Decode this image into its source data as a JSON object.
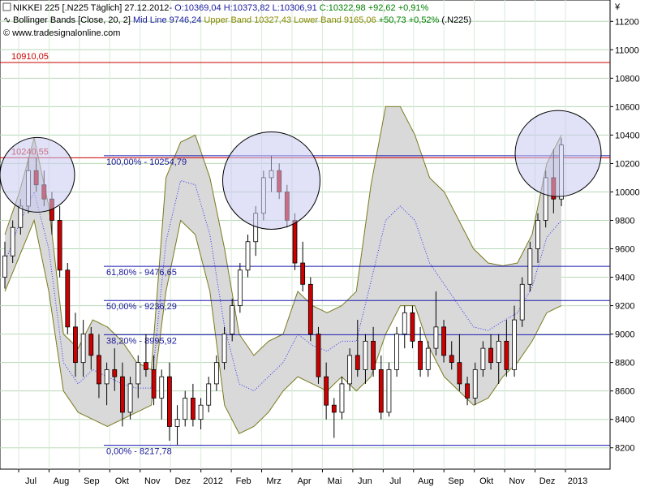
{
  "header": {
    "line1_name": "NIKKEI 225 [.N225  Täglich] 27.12.2012",
    "line1_ohlc": "- O:10369,04 H:10373,82 L:10306,91 ",
    "line1_close": "C:10322,98 +92,62 +0,91%",
    "line2_prefix": "Bollinger Bands [Close, 20, 2]",
    "line2_mid": " Mid Line 9746,24",
    "line2_bands": " Upper Band 10327,43 Lower Band 9165,06",
    "line2_change": " +50,73 +0,52%",
    "line2_suffix": " (.N225)",
    "copyright": "© www.tradesignalonline.com"
  },
  "colors": {
    "up_candle": "#ffffff",
    "down_candle": "#cc0000",
    "band_fill": "#d9d9d9",
    "band_line": "#7a7a1e",
    "mid_line": "#3030ff",
    "fib_line": "#1a1ab0",
    "resistance_line": "#cc0000",
    "circle_fill": "#c8c8f0"
  },
  "chart_data": {
    "type": "candlestick",
    "currency_label": "¥",
    "y_ticks": [
      8200,
      8400,
      8600,
      8800,
      9000,
      9200,
      9400,
      9600,
      9800,
      10000,
      10200,
      10400,
      10600,
      10800,
      11000,
      11200
    ],
    "y_tick_labels": [
      "8200",
      "8400",
      "8600",
      "8800",
      "9000",
      "9200",
      "9400",
      "9600",
      "9800",
      "10000",
      "10200",
      "10400",
      "10600",
      "10800",
      "11000",
      "11200"
    ],
    "ylim": [
      8050,
      11350
    ],
    "x_labels": [
      "Jul",
      "Aug",
      "Sep",
      "Okt",
      "Nov",
      "Dez",
      "2012",
      "Feb",
      "Mrz",
      "Apr",
      "Mai",
      "Jun",
      "Jul",
      "Aug",
      "Sep",
      "Okt",
      "Nov",
      "Dez",
      "2013"
    ],
    "bollinger_series": {
      "x": [
        0,
        10,
        20,
        30,
        40,
        50,
        60,
        70,
        80,
        90,
        100,
        110,
        120,
        130,
        140,
        150,
        160,
        170,
        180,
        190,
        200,
        210,
        220,
        230,
        240,
        250,
        260,
        270,
        280,
        290,
        300,
        310,
        320,
        330,
        340,
        350,
        360,
        370,
        380
      ],
      "upper": [
        9700,
        10000,
        10380,
        9900,
        9000,
        8900,
        9100,
        9050,
        8950,
        8800,
        8750,
        10100,
        10350,
        10400,
        10100,
        9600,
        9000,
        8850,
        8950,
        9000,
        9300,
        9200,
        9150,
        9200,
        9300,
        10050,
        10600,
        10600,
        10400,
        10100,
        10000,
        9800,
        9600,
        9500,
        9480,
        9500,
        9700,
        10200,
        10400
      ],
      "lower": [
        9300,
        9550,
        9800,
        9300,
        8600,
        8450,
        8400,
        8350,
        8400,
        8450,
        8500,
        9300,
        9800,
        9700,
        9300,
        8500,
        8300,
        8350,
        8450,
        8600,
        8700,
        8650,
        8600,
        8700,
        8600,
        8700,
        9000,
        9200,
        9200,
        8900,
        8700,
        8600,
        8500,
        8550,
        8700,
        8800,
        8950,
        9150,
        9200
      ],
      "mid": [
        9500,
        9780,
        10000,
        9600,
        8800,
        8650,
        8750,
        8700,
        8650,
        8620,
        8620,
        9650,
        10080,
        10050,
        9700,
        9050,
        8650,
        8600,
        8700,
        8800,
        9000,
        8920,
        8880,
        8950,
        8950,
        9370,
        9800,
        9900,
        9800,
        9500,
        9350,
        9200,
        9050,
        9025,
        9090,
        9150,
        9330,
        9680,
        9800
      ]
    },
    "candles": [
      {
        "o": 9400,
        "h": 9650,
        "l": 9320,
        "c": 9550
      },
      {
        "o": 9550,
        "h": 9800,
        "l": 9500,
        "c": 9750
      },
      {
        "o": 9750,
        "h": 9950,
        "l": 9700,
        "c": 9900
      },
      {
        "o": 9900,
        "h": 10240,
        "l": 9850,
        "c": 10150
      },
      {
        "o": 10150,
        "h": 10240,
        "l": 10000,
        "c": 10050
      },
      {
        "o": 10050,
        "h": 10150,
        "l": 9900,
        "c": 9950
      },
      {
        "o": 9950,
        "h": 10000,
        "l": 9700,
        "c": 9800
      },
      {
        "o": 9800,
        "h": 9900,
        "l": 9400,
        "c": 9450
      },
      {
        "o": 9450,
        "h": 9500,
        "l": 9000,
        "c": 9050
      },
      {
        "o": 9050,
        "h": 9150,
        "l": 8700,
        "c": 8800
      },
      {
        "o": 8800,
        "h": 9100,
        "l": 8700,
        "c": 9000
      },
      {
        "o": 9000,
        "h": 9050,
        "l": 8750,
        "c": 8850
      },
      {
        "o": 8850,
        "h": 9000,
        "l": 8550,
        "c": 8650
      },
      {
        "o": 8650,
        "h": 8800,
        "l": 8500,
        "c": 8750
      },
      {
        "o": 8750,
        "h": 8900,
        "l": 8600,
        "c": 8700
      },
      {
        "o": 8700,
        "h": 8800,
        "l": 8350,
        "c": 8450
      },
      {
        "o": 8450,
        "h": 8700,
        "l": 8400,
        "c": 8650
      },
      {
        "o": 8650,
        "h": 8850,
        "l": 8550,
        "c": 8800
      },
      {
        "o": 8800,
        "h": 9000,
        "l": 8700,
        "c": 8750
      },
      {
        "o": 8750,
        "h": 8850,
        "l": 8500,
        "c": 8550
      },
      {
        "o": 8550,
        "h": 8750,
        "l": 8400,
        "c": 8700
      },
      {
        "o": 8700,
        "h": 8800,
        "l": 8250,
        "c": 8350
      },
      {
        "o": 8350,
        "h": 8500,
        "l": 8220,
        "c": 8400
      },
      {
        "o": 8400,
        "h": 8600,
        "l": 8350,
        "c": 8550
      },
      {
        "o": 8550,
        "h": 8650,
        "l": 8350,
        "c": 8400
      },
      {
        "o": 8400,
        "h": 8550,
        "l": 8330,
        "c": 8500
      },
      {
        "o": 8500,
        "h": 8700,
        "l": 8450,
        "c": 8650
      },
      {
        "o": 8650,
        "h": 8850,
        "l": 8600,
        "c": 8800
      },
      {
        "o": 8800,
        "h": 9050,
        "l": 8750,
        "c": 9000
      },
      {
        "o": 9000,
        "h": 9250,
        "l": 8950,
        "c": 9200
      },
      {
        "o": 9200,
        "h": 9500,
        "l": 9150,
        "c": 9450
      },
      {
        "o": 9450,
        "h": 9700,
        "l": 9400,
        "c": 9650
      },
      {
        "o": 9650,
        "h": 9900,
        "l": 9550,
        "c": 9850
      },
      {
        "o": 9850,
        "h": 10150,
        "l": 9800,
        "c": 10100
      },
      {
        "o": 10100,
        "h": 10255,
        "l": 10000,
        "c": 10150
      },
      {
        "o": 10150,
        "h": 10200,
        "l": 9950,
        "c": 10000
      },
      {
        "o": 10000,
        "h": 10050,
        "l": 9750,
        "c": 9800
      },
      {
        "o": 9800,
        "h": 9850,
        "l": 9450,
        "c": 9500
      },
      {
        "o": 9500,
        "h": 9650,
        "l": 9300,
        "c": 9350
      },
      {
        "o": 9350,
        "h": 9400,
        "l": 8950,
        "c": 9000
      },
      {
        "o": 9000,
        "h": 9050,
        "l": 8650,
        "c": 8700
      },
      {
        "o": 8700,
        "h": 8800,
        "l": 8400,
        "c": 8500
      },
      {
        "o": 8500,
        "h": 8550,
        "l": 8270,
        "c": 8450
      },
      {
        "o": 8450,
        "h": 8700,
        "l": 8400,
        "c": 8650
      },
      {
        "o": 8650,
        "h": 8900,
        "l": 8600,
        "c": 8850
      },
      {
        "o": 8850,
        "h": 9100,
        "l": 8700,
        "c": 8750
      },
      {
        "o": 8750,
        "h": 9000,
        "l": 8650,
        "c": 8950
      },
      {
        "o": 8950,
        "h": 9050,
        "l": 8700,
        "c": 8750
      },
      {
        "o": 8750,
        "h": 8850,
        "l": 8400,
        "c": 8450
      },
      {
        "o": 8450,
        "h": 8800,
        "l": 8420,
        "c": 8750
      },
      {
        "o": 8750,
        "h": 9050,
        "l": 8700,
        "c": 9000
      },
      {
        "o": 9000,
        "h": 9200,
        "l": 8900,
        "c": 9150
      },
      {
        "o": 9150,
        "h": 9200,
        "l": 8900,
        "c": 8950
      },
      {
        "o": 8950,
        "h": 9050,
        "l": 8700,
        "c": 8750
      },
      {
        "o": 8750,
        "h": 8950,
        "l": 8700,
        "c": 8900
      },
      {
        "o": 8900,
        "h": 9300,
        "l": 8850,
        "c": 9050
      },
      {
        "o": 9050,
        "h": 9100,
        "l": 8800,
        "c": 8850
      },
      {
        "o": 8850,
        "h": 8950,
        "l": 8750,
        "c": 8800
      },
      {
        "o": 8800,
        "h": 9000,
        "l": 8600,
        "c": 8650
      },
      {
        "o": 8650,
        "h": 8700,
        "l": 8500,
        "c": 8550
      },
      {
        "o": 8550,
        "h": 8800,
        "l": 8500,
        "c": 8750
      },
      {
        "o": 8750,
        "h": 8950,
        "l": 8700,
        "c": 8900
      },
      {
        "o": 8900,
        "h": 9000,
        "l": 8750,
        "c": 8800
      },
      {
        "o": 8800,
        "h": 9000,
        "l": 8650,
        "c": 8950
      },
      {
        "o": 8950,
        "h": 9100,
        "l": 8700,
        "c": 8750
      },
      {
        "o": 8750,
        "h": 9200,
        "l": 8700,
        "c": 9100
      },
      {
        "o": 9100,
        "h": 9400,
        "l": 9050,
        "c": 9350
      },
      {
        "o": 9350,
        "h": 9650,
        "l": 9300,
        "c": 9600
      },
      {
        "o": 9600,
        "h": 9850,
        "l": 9500,
        "c": 9800
      },
      {
        "o": 9800,
        "h": 10150,
        "l": 9750,
        "c": 10100
      },
      {
        "o": 10100,
        "h": 10300,
        "l": 9850,
        "c": 9950
      },
      {
        "o": 9950,
        "h": 10380,
        "l": 9900,
        "c": 10330
      }
    ],
    "horizontal_levels": [
      {
        "value": 10910.05,
        "label": "10910,05",
        "kind": "resistance"
      },
      {
        "value": 10240.55,
        "label": "10240,55",
        "kind": "resistance"
      },
      {
        "value": 10254.79,
        "label": "100,00% - 10254,79",
        "kind": "fibonacci"
      },
      {
        "value": 9476.65,
        "label": "61,80% - 9476,65",
        "kind": "fibonacci"
      },
      {
        "value": 9236.29,
        "label": "50,00% - 9236,29",
        "kind": "fibonacci"
      },
      {
        "value": 8995.92,
        "label": "38,20% - 8995,92",
        "kind": "fibonacci"
      },
      {
        "value": 8217.78,
        "label": "0,00% - 8217,78",
        "kind": "fibonacci"
      }
    ],
    "grid": true
  }
}
